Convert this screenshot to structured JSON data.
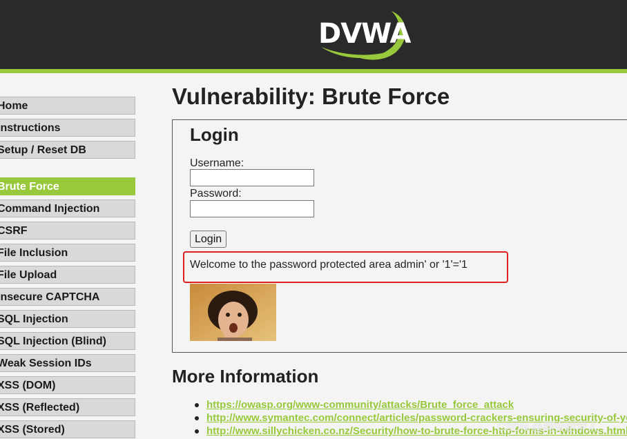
{
  "header": {
    "logo_text": "DVWA",
    "colors": {
      "header_bg": "#2a2a2a",
      "accent": "#98c93c"
    }
  },
  "menu": {
    "items": [
      {
        "label": "Home",
        "selected": false
      },
      {
        "label": "Instructions",
        "selected": false
      },
      {
        "label": "Setup / Reset DB",
        "selected": false
      },
      {
        "label": "Brute Force",
        "selected": true
      },
      {
        "label": "Command Injection",
        "selected": false
      },
      {
        "label": "CSRF",
        "selected": false
      },
      {
        "label": "File Inclusion",
        "selected": false
      },
      {
        "label": "File Upload",
        "selected": false
      },
      {
        "label": "Insecure CAPTCHA",
        "selected": false
      },
      {
        "label": "SQL Injection",
        "selected": false
      },
      {
        "label": "SQL Injection (Blind)",
        "selected": false
      },
      {
        "label": "Weak Session IDs",
        "selected": false
      },
      {
        "label": "XSS (DOM)",
        "selected": false
      },
      {
        "label": "XSS (Reflected)",
        "selected": false
      },
      {
        "label": "XSS (Stored)",
        "selected": false
      }
    ]
  },
  "main": {
    "title": "Vulnerability: Brute Force",
    "login": {
      "heading": "Login",
      "username_label": "Username:",
      "username_value": "",
      "password_label": "Password:",
      "password_value": "",
      "button_label": "Login",
      "welcome_message": "Welcome to the password protected area admin' or '1'='1"
    },
    "more_info": {
      "heading": "More Information",
      "links": [
        "https://owasp.org/www-community/attacks/Brute_force_attack",
        "http://www.symantec.com/connect/articles/password-crackers-ensuring-security-of-your-password",
        "http://www.sillychicken.co.nz/Security/how-to-brute-force-http-forms-in-windows.html"
      ]
    }
  },
  "watermark": "CSDN @网安初学人"
}
